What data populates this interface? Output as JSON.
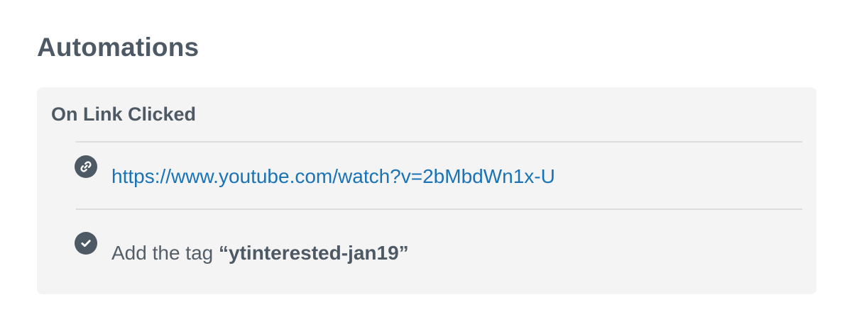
{
  "heading": "Automations",
  "automation": {
    "trigger_title": "On Link Clicked",
    "link": {
      "icon": "link-icon",
      "url": "https://www.youtube.com/watch?v=2bMbdWn1x-U"
    },
    "action": {
      "icon": "check-circle-icon",
      "prefix": "Add the tag",
      "tag": "“ytinterested-jan19”"
    }
  },
  "colors": {
    "text_dark": "#4d5964",
    "link": "#1a73b5",
    "card_bg": "#f4f4f4"
  }
}
